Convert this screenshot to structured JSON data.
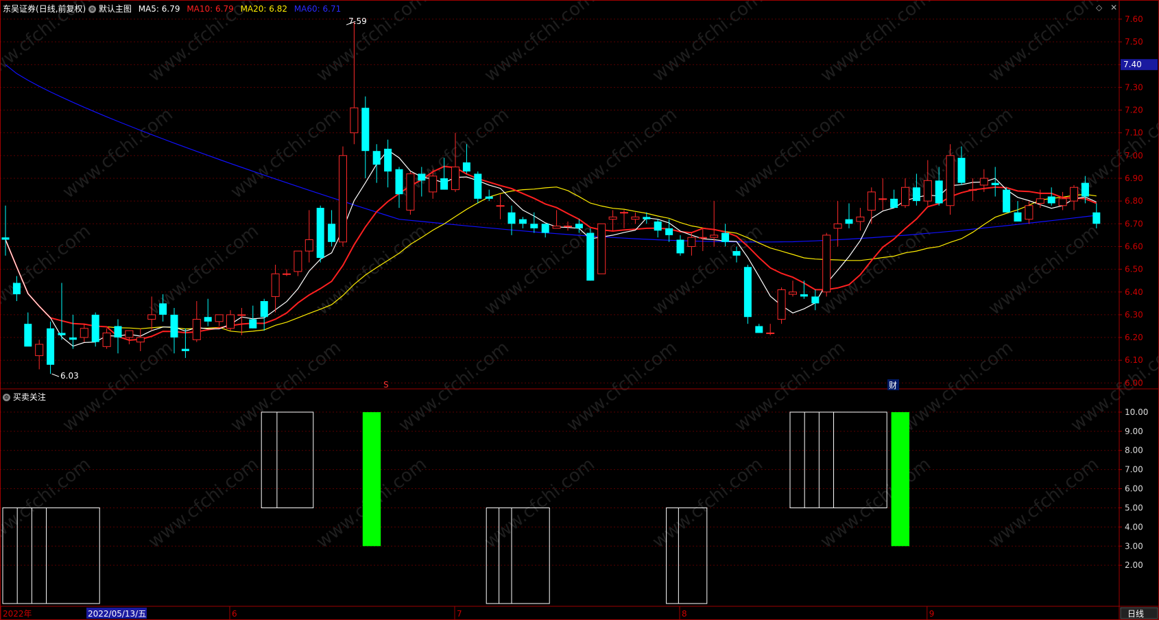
{
  "header": {
    "title": "东吴证券",
    "mode": "(日线,前复权)",
    "main_chart_label": "默认主图",
    "ma": [
      {
        "label": "MA5: 6.79",
        "color": "#ffffff"
      },
      {
        "label": "MA10: 6.79",
        "color": "#ff2020"
      },
      {
        "label": "MA20: 6.82",
        "color": "#ffee00"
      },
      {
        "label": "MA60: 6.71",
        "color": "#1010ff"
      }
    ]
  },
  "sub_header": {
    "label": "买卖关注"
  },
  "price_axis": {
    "ticks": [
      "7.60",
      "7.50",
      "7.40",
      "7.30",
      "7.20",
      "7.10",
      "7.00",
      "6.90",
      "6.80",
      "6.70",
      "6.60",
      "6.50",
      "6.40",
      "6.30",
      "6.20",
      "6.10",
      "6.00"
    ],
    "current_label": "7.40",
    "range": [
      5.98,
      7.66
    ]
  },
  "indicator_axis": {
    "ticks": [
      "10.00",
      "9.00",
      "8.00",
      "7.00",
      "6.00",
      "5.00",
      "4.00",
      "3.00",
      "2.00"
    ],
    "range": [
      0,
      10.75
    ]
  },
  "annotations": {
    "high": "7.59",
    "low": "6.03",
    "event_s": "S",
    "event_cai": "财"
  },
  "time_axis": {
    "labels": [
      "2022年",
      "6",
      "7",
      "8",
      "9"
    ],
    "highlight": "2022/05/13/五",
    "period_button": "日线"
  },
  "colors": {
    "up": "#ff2a2a",
    "down": "#00ffff",
    "grid": "#5a0000",
    "frame": "#a00000",
    "signal": "#00ff00"
  },
  "chart_data": {
    "type": "candlestick",
    "candles": [
      [
        6.64,
        6.78,
        6.56,
        6.63
      ],
      [
        6.44,
        6.47,
        6.36,
        6.39
      ],
      [
        6.26,
        6.31,
        6.21,
        6.16
      ],
      [
        6.12,
        6.19,
        6.06,
        6.17
      ],
      [
        6.24,
        6.27,
        6.04,
        6.08
      ],
      [
        6.22,
        6.44,
        6.19,
        6.21
      ],
      [
        6.2,
        6.3,
        6.15,
        6.19
      ],
      [
        6.2,
        6.26,
        6.18,
        6.24
      ],
      [
        6.3,
        6.31,
        6.16,
        6.18
      ],
      [
        6.16,
        6.24,
        6.15,
        6.22
      ],
      [
        6.25,
        6.28,
        6.13,
        6.2
      ],
      [
        6.2,
        6.23,
        6.17,
        6.23
      ],
      [
        6.18,
        6.24,
        6.14,
        6.2
      ],
      [
        6.28,
        6.38,
        6.23,
        6.3
      ],
      [
        6.35,
        6.39,
        6.27,
        6.3
      ],
      [
        6.3,
        6.33,
        6.13,
        6.2
      ],
      [
        6.15,
        6.24,
        6.11,
        6.14
      ],
      [
        6.19,
        6.36,
        6.18,
        6.28
      ],
      [
        6.29,
        6.37,
        6.25,
        6.27
      ],
      [
        6.27,
        6.3,
        6.25,
        6.3
      ],
      [
        6.24,
        6.32,
        6.23,
        6.3
      ],
      [
        6.3,
        6.33,
        6.21,
        6.3
      ],
      [
        6.28,
        6.34,
        6.24,
        6.24
      ],
      [
        6.36,
        6.37,
        6.23,
        6.29
      ],
      [
        6.38,
        6.52,
        6.31,
        6.48
      ],
      [
        6.48,
        6.5,
        6.47,
        6.48
      ],
      [
        6.49,
        6.58,
        6.47,
        6.58
      ],
      [
        6.58,
        6.76,
        6.53,
        6.63
      ],
      [
        6.77,
        6.78,
        6.53,
        6.55
      ],
      [
        6.7,
        6.76,
        6.6,
        6.62
      ],
      [
        6.62,
        7.04,
        6.6,
        7.0
      ],
      [
        7.1,
        7.59,
        7.05,
        7.21
      ],
      [
        7.21,
        7.26,
        6.9,
        7.02
      ],
      [
        7.02,
        7.05,
        6.88,
        6.96
      ],
      [
        7.03,
        7.07,
        6.86,
        6.93
      ],
      [
        6.94,
        6.95,
        6.77,
        6.83
      ],
      [
        6.76,
        6.93,
        6.74,
        6.92
      ],
      [
        6.92,
        6.95,
        6.82,
        6.89
      ],
      [
        6.84,
        6.94,
        6.81,
        6.91
      ],
      [
        6.9,
        6.99,
        6.85,
        6.85
      ],
      [
        6.85,
        7.1,
        6.84,
        6.95
      ],
      [
        6.97,
        7.05,
        6.92,
        6.93
      ],
      [
        6.92,
        6.93,
        6.79,
        6.81
      ],
      [
        6.82,
        6.85,
        6.8,
        6.81
      ],
      [
        6.78,
        6.83,
        6.72,
        6.78
      ],
      [
        6.75,
        6.78,
        6.65,
        6.7
      ],
      [
        6.72,
        6.73,
        6.68,
        6.7
      ],
      [
        6.7,
        6.75,
        6.66,
        6.68
      ],
      [
        6.7,
        6.7,
        6.64,
        6.66
      ],
      [
        6.68,
        6.76,
        6.68,
        6.69
      ],
      [
        6.69,
        6.71,
        6.67,
        6.69
      ],
      [
        6.7,
        6.72,
        6.66,
        6.68
      ],
      [
        6.66,
        6.68,
        6.45,
        6.45
      ],
      [
        6.48,
        6.7,
        6.48,
        6.7
      ],
      [
        6.72,
        6.76,
        6.67,
        6.73
      ],
      [
        6.75,
        6.76,
        6.68,
        6.75
      ],
      [
        6.72,
        6.75,
        6.7,
        6.73
      ],
      [
        6.73,
        6.75,
        6.7,
        6.72
      ],
      [
        6.71,
        6.72,
        6.64,
        6.67
      ],
      [
        6.68,
        6.72,
        6.62,
        6.65
      ],
      [
        6.63,
        6.65,
        6.56,
        6.57
      ],
      [
        6.6,
        6.66,
        6.56,
        6.64
      ],
      [
        6.64,
        6.68,
        6.58,
        6.64
      ],
      [
        6.64,
        6.8,
        6.6,
        6.65
      ],
      [
        6.66,
        6.7,
        6.6,
        6.62
      ],
      [
        6.58,
        6.6,
        6.53,
        6.56
      ],
      [
        6.51,
        6.52,
        6.26,
        6.29
      ],
      [
        6.25,
        6.26,
        6.22,
        6.22
      ],
      [
        6.22,
        6.26,
        6.21,
        6.22
      ],
      [
        6.28,
        6.42,
        6.26,
        6.41
      ],
      [
        6.39,
        6.45,
        6.38,
        6.4
      ],
      [
        6.39,
        6.45,
        6.37,
        6.38
      ],
      [
        6.38,
        6.41,
        6.32,
        6.35
      ],
      [
        6.4,
        6.66,
        6.38,
        6.65
      ],
      [
        6.68,
        6.8,
        6.6,
        6.7
      ],
      [
        6.72,
        6.79,
        6.68,
        6.7
      ],
      [
        6.71,
        6.77,
        6.67,
        6.73
      ],
      [
        6.76,
        6.86,
        6.7,
        6.84
      ],
      [
        6.81,
        6.9,
        6.76,
        6.81
      ],
      [
        6.81,
        6.85,
        6.78,
        6.77
      ],
      [
        6.78,
        6.9,
        6.77,
        6.86
      ],
      [
        6.86,
        6.92,
        6.78,
        6.8
      ],
      [
        6.8,
        6.98,
        6.78,
        6.89
      ],
      [
        6.89,
        6.95,
        6.78,
        6.79
      ],
      [
        6.78,
        7.05,
        6.74,
        7.0
      ],
      [
        6.99,
        7.04,
        6.87,
        6.88
      ],
      [
        6.85,
        6.9,
        6.8,
        6.85
      ],
      [
        6.87,
        6.94,
        6.84,
        6.9
      ],
      [
        6.88,
        6.95,
        6.82,
        6.87
      ],
      [
        6.85,
        6.86,
        6.75,
        6.75
      ],
      [
        6.75,
        6.8,
        6.71,
        6.71
      ],
      [
        6.72,
        6.8,
        6.7,
        6.78
      ],
      [
        6.79,
        6.85,
        6.77,
        6.81
      ],
      [
        6.82,
        6.86,
        6.78,
        6.79
      ],
      [
        6.78,
        6.84,
        6.76,
        6.81
      ],
      [
        6.8,
        6.87,
        6.76,
        6.86
      ],
      [
        6.88,
        6.91,
        6.79,
        6.82
      ],
      [
        6.75,
        6.79,
        6.68,
        6.7
      ]
    ],
    "ma5_end": 6.79,
    "ma10_end": 6.79,
    "ma20_end": 6.82,
    "ma60_end": 6.71,
    "signal_bars": [
      {
        "type": "box",
        "from": 0,
        "to": 8,
        "bottom": 0,
        "top": 5.0
      },
      {
        "type": "box",
        "from": 23,
        "to": 27,
        "bottom": 5.0,
        "top": 10.0
      },
      {
        "type": "solid",
        "from": 32,
        "to": 33,
        "bottom": 3.0,
        "top": 10.0
      },
      {
        "type": "box",
        "from": 43,
        "to": 48,
        "bottom": 0,
        "top": 5.0
      },
      {
        "type": "box",
        "from": 59,
        "to": 62,
        "bottom": 0,
        "top": 5.0
      },
      {
        "type": "box",
        "from": 70,
        "to": 78,
        "bottom": 5.0,
        "top": 10.0
      },
      {
        "type": "solid",
        "from": 79,
        "to": 80,
        "bottom": 3.0,
        "top": 10.0
      }
    ]
  }
}
